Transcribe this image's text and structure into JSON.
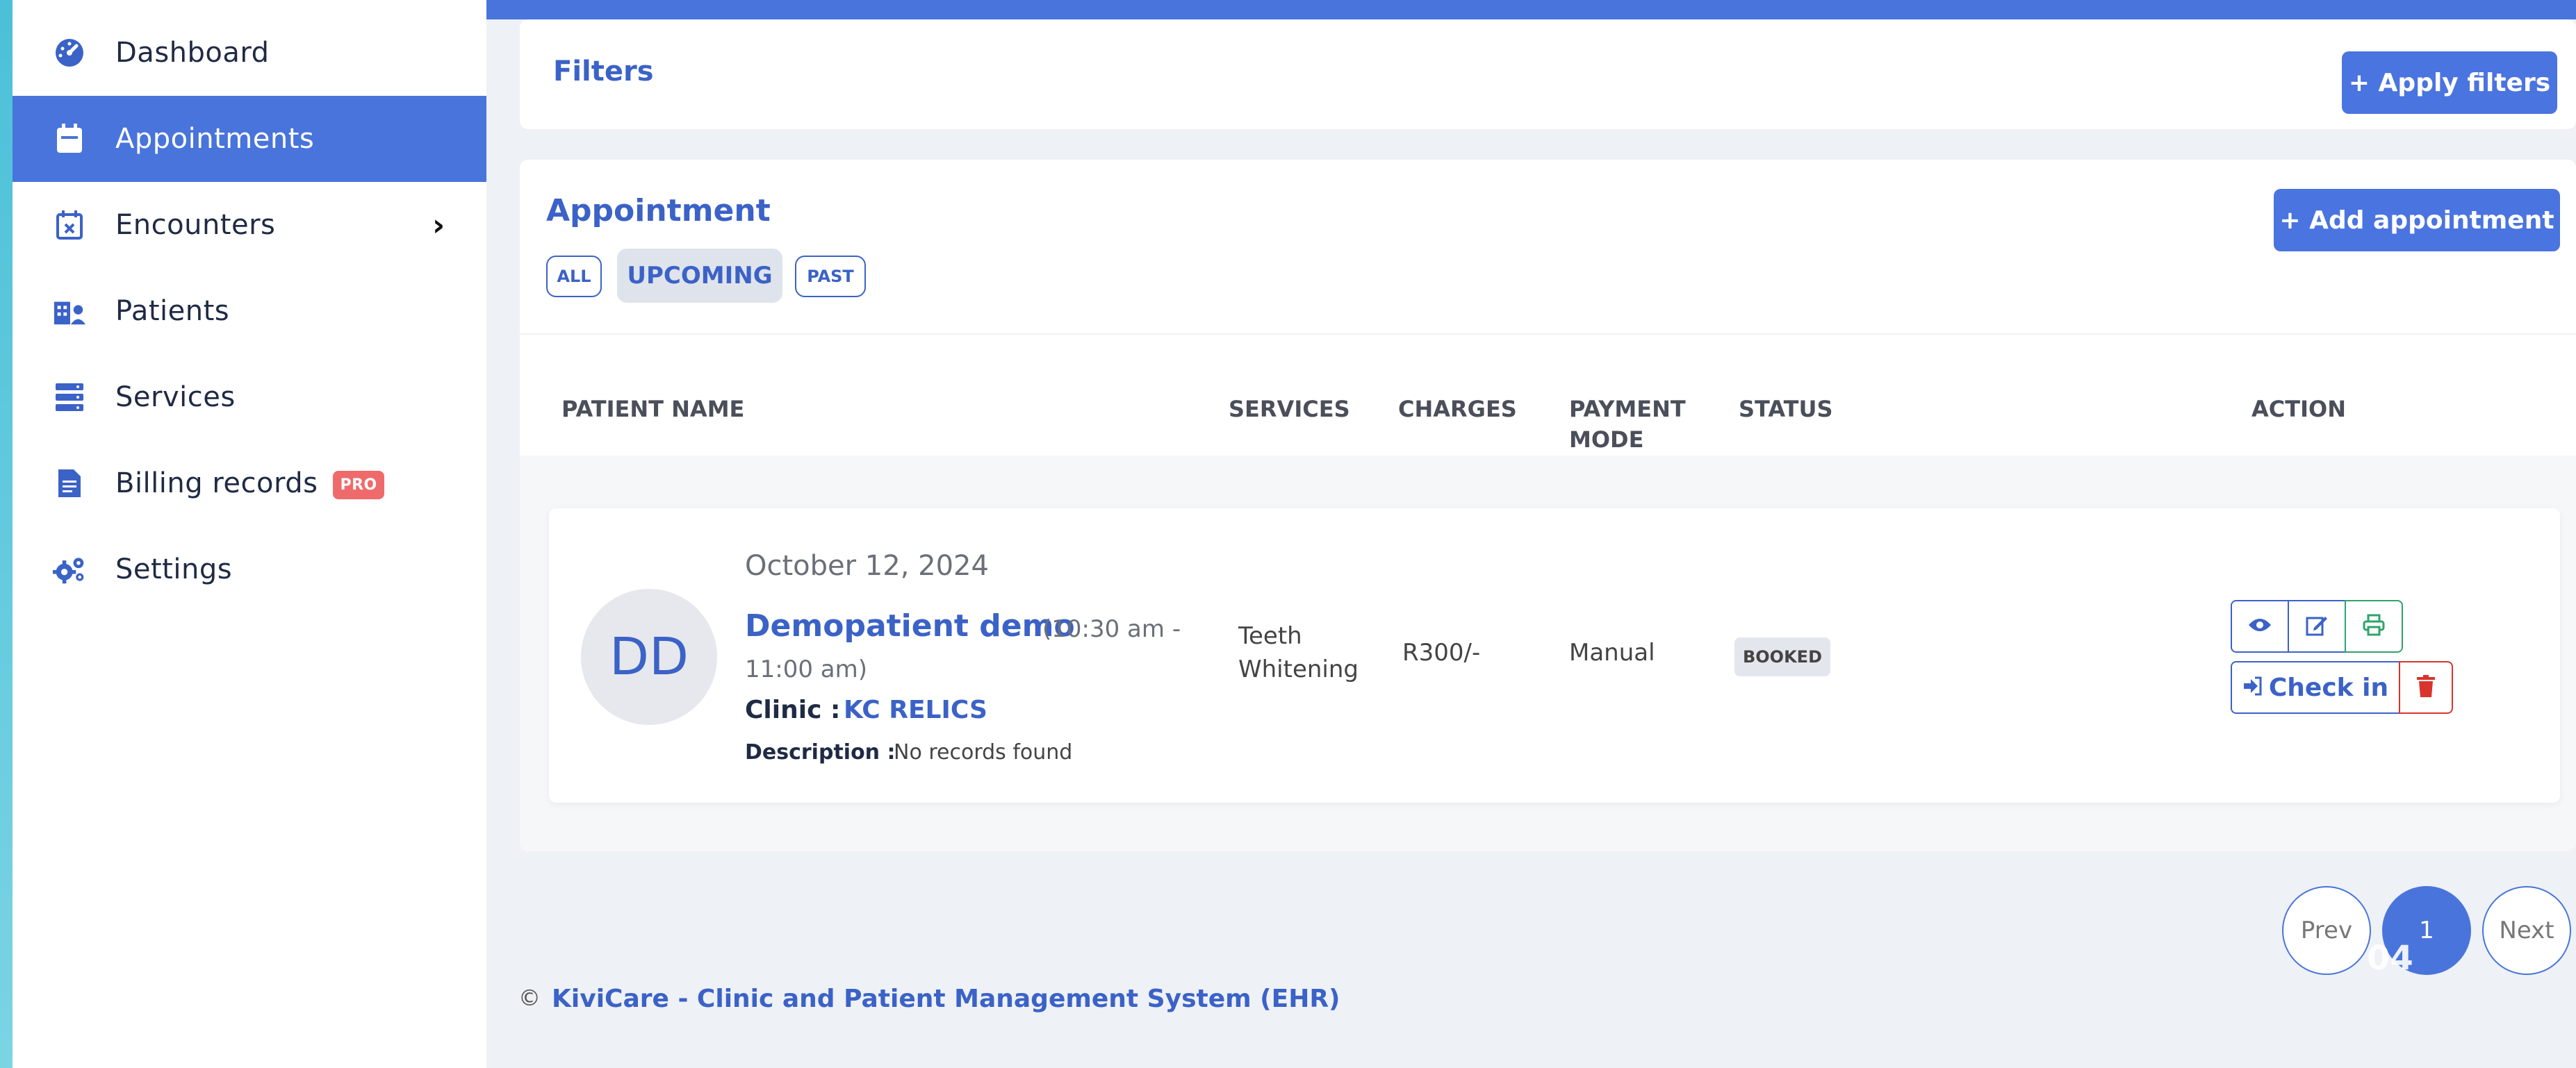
{
  "sidebar": {
    "items": [
      {
        "label": "Dashboard",
        "icon": "dashboard-gauge-icon"
      },
      {
        "label": "Appointments",
        "icon": "calendar-icon"
      },
      {
        "label": "Encounters",
        "icon": "calendar-x-icon"
      },
      {
        "label": "Patients",
        "icon": "patients-icon"
      },
      {
        "label": "Services",
        "icon": "server-list-icon"
      },
      {
        "label": "Billing records",
        "icon": "invoice-icon",
        "badge": "PRO"
      },
      {
        "label": "Settings",
        "icon": "gears-icon"
      }
    ]
  },
  "filters": {
    "title": "Filters",
    "apply_label": "+ Apply filters"
  },
  "appointments": {
    "title": "Appointment",
    "add_label": "+ Add appointment",
    "tabs": [
      "ALL",
      "UPCOMING",
      "PAST"
    ],
    "columns": [
      "PATIENT NAME",
      "SERVICES",
      "CHARGES",
      "PAYMENT",
      "MODE",
      "STATUS",
      "ACTION"
    ],
    "row": {
      "initials": "DD",
      "date": "October 12, 2024",
      "patient_name": "Demopatient demo",
      "time_start": "(10:30 am -",
      "time_end": "11:00 am)",
      "clinic_label": "Clinic :",
      "clinic_name": "KC RELICS",
      "description_label": "Description :",
      "description_value": "No records found",
      "service_line1": "Teeth",
      "service_line2": "Whitening",
      "charges": "R300/-",
      "payment_mode": "Manual",
      "status": "BOOKED",
      "checkin_label": "Check in"
    }
  },
  "pagination": {
    "prev": "Prev",
    "current": "1",
    "next": "Next",
    "overlay": "04"
  },
  "footer": {
    "symbol": "©",
    "text": "KiviCare - Clinic and Patient Management System (EHR)"
  },
  "colors": {
    "primary": "#4874dc",
    "danger": "#d9342b",
    "success": "#2fa36b",
    "pro_badge": "#ef6a6a"
  }
}
